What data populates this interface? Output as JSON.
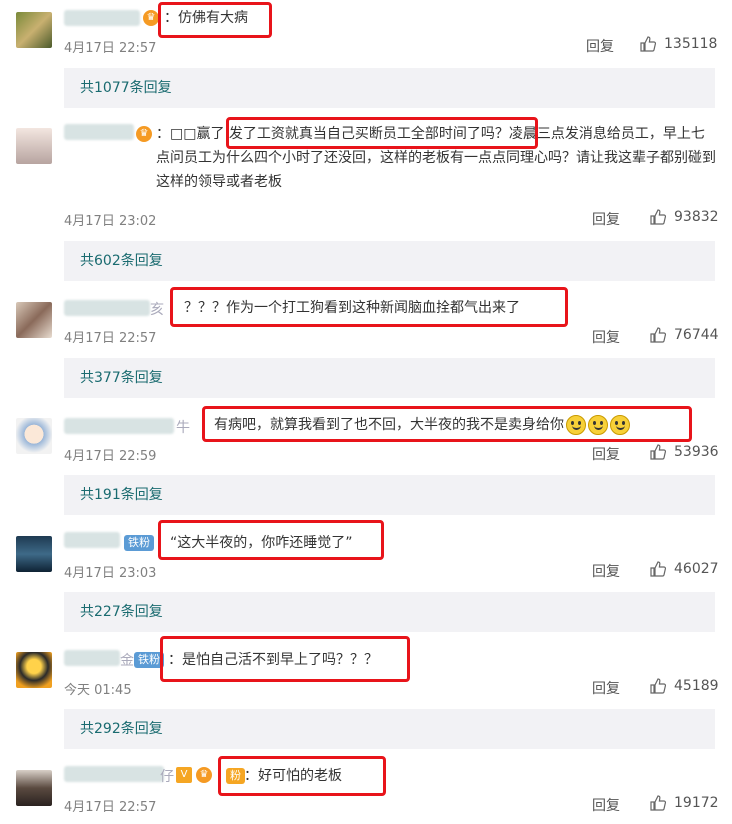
{
  "comments": [
    {
      "avatar": "dog-avatar",
      "text": "：仿佛有大病",
      "time": "4月17日 22:57",
      "reply": "回复",
      "likes": "135118",
      "more": "共1077条回复"
    },
    {
      "avatar": "cartoon-boy-avatar",
      "text_prefix": "：□□赢了 ",
      "text_hl": "发了工资就真当自己买断员工全部时间了吗？",
      "text_rest": "凌晨三点发消息给员工，早上七点问员工为什么四个小时了还没回，这样的老板有一点点同理心吗？请让我这辈子都别碰到这样的领导或者老板",
      "time": "4月17日 23:02",
      "reply": "回复",
      "likes": "93832",
      "more": "共602条回复"
    },
    {
      "avatar": "woman-photo-avatar",
      "name_tail": "亥",
      "text": "？？？作为一个打工狗看到这种新闻脑血拴都气出来了",
      "time": "4月17日 22:57",
      "reply": "回复",
      "likes": "76744",
      "more": "共377条回复"
    },
    {
      "avatar": "cartoon-girl-avatar",
      "name_tail": "牛",
      "text": "有病吧，就算我看到了也不回，大半夜的我不是卖身给你",
      "time": "4月17日 22:59",
      "reply": "回复",
      "likes": "53936",
      "more": "共191条回复"
    },
    {
      "avatar": "ocean-avatar",
      "badge": "铁粉",
      "text": "“这大半夜的，你咋还睡觉了”",
      "time": "4月17日 23:03",
      "reply": "回复",
      "likes": "46027",
      "more": "共227条回复"
    },
    {
      "avatar": "anime-avatar",
      "name_tail": "金",
      "badge": "铁粉",
      "text": "：是怕自己活不到早上了吗？？？",
      "time": "今天 01:45",
      "reply": "回复",
      "likes": "45189",
      "more": "共292条回复"
    },
    {
      "avatar": "woman-portrait-avatar",
      "name_tail": "仔",
      "badge": "粉",
      "text": "：好可怕的老板",
      "time": "4月17日 22:57",
      "reply": "回复",
      "likes": "19172"
    }
  ],
  "colors": {
    "highlight": "#e8141a",
    "more_link": "#1a6b70",
    "more_bg": "#f2f2f5"
  }
}
